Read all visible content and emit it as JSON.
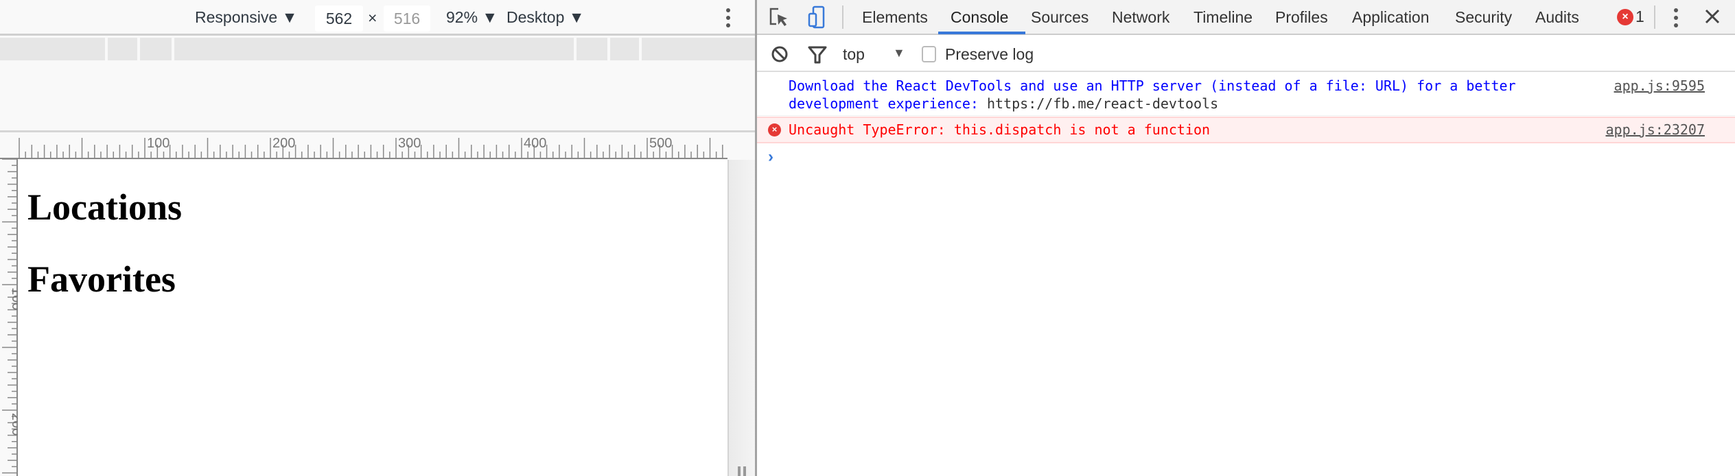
{
  "device_toolbar": {
    "device": "Responsive",
    "width": "562",
    "height": "516",
    "times": "×",
    "zoom": "92%",
    "mode": "Desktop"
  },
  "ruler": {
    "h_labels": [
      "100",
      "200",
      "300",
      "400",
      "500"
    ],
    "v_labels": [
      "100",
      "200"
    ]
  },
  "page": {
    "headings": [
      "Locations",
      "Favorites"
    ]
  },
  "devtools": {
    "tabs": [
      "Elements",
      "Console",
      "Sources",
      "Network",
      "Timeline",
      "Profiles",
      "Application",
      "Security",
      "Audits"
    ],
    "active_tab": "Console",
    "error_count": "1",
    "accent": "#3879d9"
  },
  "console_toolbar": {
    "context": "top",
    "preserve_log": "Preserve log",
    "preserve_checked": false
  },
  "messages": [
    {
      "type": "log",
      "text1": "Download the React DevTools and use an HTTP server (instead of a file: URL) for a better",
      "text2": "development experience:",
      "url": "https://fb.me/react-devtools",
      "source": "app.js:9595",
      "color": "#0000ff"
    },
    {
      "type": "error",
      "text": "Uncaught TypeError: this.dispatch is not a function",
      "source": "app.js:23207",
      "color": "#ff0000"
    }
  ]
}
